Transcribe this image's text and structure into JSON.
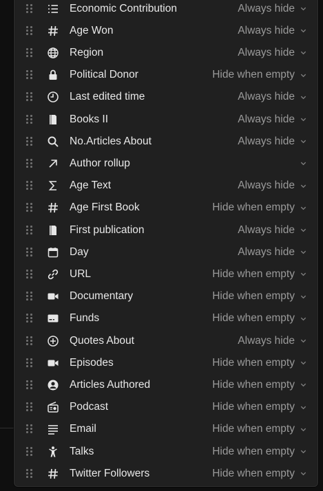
{
  "properties": [
    {
      "icon": "list-icon",
      "label": "Economic Contribution",
      "value": "Always hide"
    },
    {
      "icon": "hash-icon",
      "label": "Age Won",
      "value": "Always hide"
    },
    {
      "icon": "globe-icon",
      "label": "Region",
      "value": "Always hide"
    },
    {
      "icon": "lock-icon",
      "label": "Political Donor",
      "value": "Hide when empty"
    },
    {
      "icon": "clock-icon",
      "label": "Last edited time",
      "value": "Always hide"
    },
    {
      "icon": "page-icon",
      "label": "Books II",
      "value": "Always hide"
    },
    {
      "icon": "search-icon",
      "label": "No.Articles About",
      "value": "Always hide"
    },
    {
      "icon": "arrow-up-right-icon",
      "label": "Author rollup",
      "value": ""
    },
    {
      "icon": "sigma-icon",
      "label": "Age Text",
      "value": "Always hide"
    },
    {
      "icon": "hash-icon",
      "label": "Age First Book",
      "value": "Hide when empty"
    },
    {
      "icon": "page-icon",
      "label": "First publication",
      "value": "Always hide"
    },
    {
      "icon": "calendar-icon",
      "label": "Day",
      "value": "Always hide"
    },
    {
      "icon": "link-icon",
      "label": "URL",
      "value": "Hide when empty"
    },
    {
      "icon": "video-icon",
      "label": "Documentary",
      "value": "Hide when empty"
    },
    {
      "icon": "card-icon",
      "label": "Funds",
      "value": "Hide when empty"
    },
    {
      "icon": "plus-circle-icon",
      "label": "Quotes About",
      "value": "Always hide"
    },
    {
      "icon": "video-icon",
      "label": "Episodes",
      "value": "Hide when empty"
    },
    {
      "icon": "person-circle-icon",
      "label": "Articles Authored",
      "value": "Hide when empty"
    },
    {
      "icon": "radio-icon",
      "label": "Podcast",
      "value": "Hide when empty"
    },
    {
      "icon": "text-lines-icon",
      "label": "Email",
      "value": "Hide when empty"
    },
    {
      "icon": "person-icon",
      "label": "Talks",
      "value": "Hide when empty"
    },
    {
      "icon": "hash-icon",
      "label": "Twitter Followers",
      "value": "Hide when empty"
    }
  ]
}
